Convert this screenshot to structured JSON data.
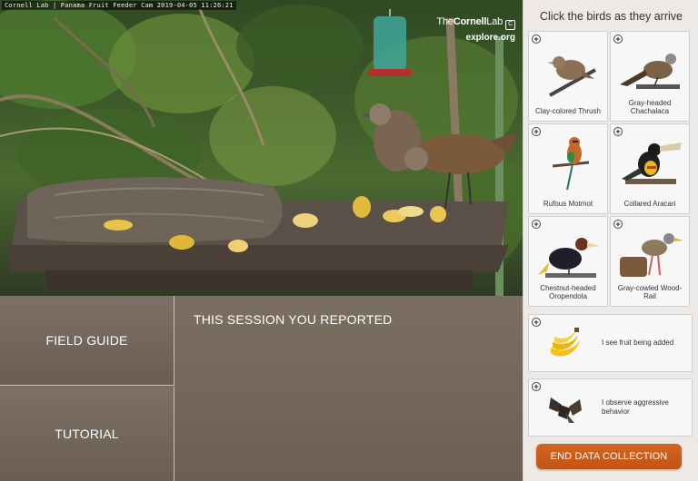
{
  "video": {
    "caption": "Cornell Lab | Panama Fruit Feeder Cam 2019-04-05 11:26:21",
    "logo_brand_light": "The",
    "logo_brand_bold": "Cornell",
    "logo_brand_tail": "Lab",
    "logo_site": "explore.org"
  },
  "left_nav": {
    "field_guide": "FIELD GUIDE",
    "tutorial": "TUTORIAL"
  },
  "session": {
    "title": "THIS SESSION YOU REPORTED"
  },
  "panel": {
    "title": "Click the birds as they arrive",
    "plus_symbol": "+",
    "birds": [
      {
        "name": "Clay-colored Thrush",
        "icon": "clay-colored-thrush-icon"
      },
      {
        "name": "Gray-headed Chachalaca",
        "icon": "gray-headed-chachalaca-icon"
      },
      {
        "name": "Rufous Motmot",
        "icon": "rufous-motmot-icon"
      },
      {
        "name": "Collared Aracari",
        "icon": "collared-aracari-icon"
      },
      {
        "name": "Chestnut-headed Oropendola",
        "icon": "chestnut-headed-oropendola-icon"
      },
      {
        "name": "Gray-cowled Wood-Rail",
        "icon": "gray-cowled-wood-rail-icon"
      }
    ],
    "behaviors": [
      {
        "text": "I see fruit being added",
        "icon": "banana-icon"
      },
      {
        "text": "I observe aggressive behavior",
        "icon": "fighting-birds-icon"
      }
    ],
    "end_button": "END DATA COLLECTION"
  },
  "colors": {
    "end_button": "#c85a19",
    "bottom_panel": "#736659",
    "panel_bg": "#ece9e6"
  }
}
